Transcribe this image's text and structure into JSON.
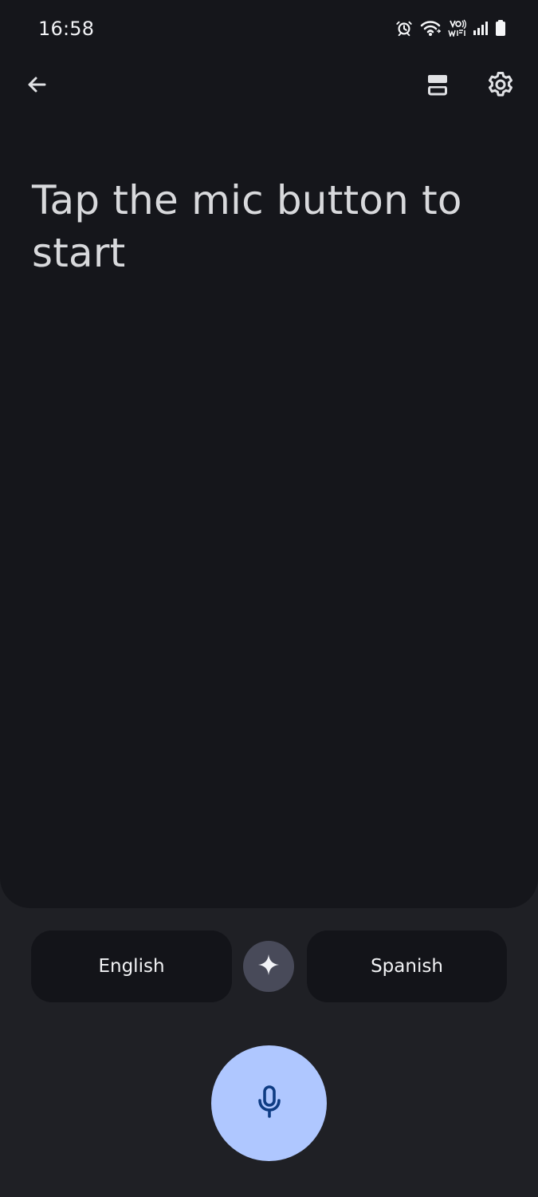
{
  "status_bar": {
    "time": "16:58",
    "icons": [
      "alarm-icon",
      "wifi-icon",
      "vowifi-icon",
      "signal-icon",
      "battery-icon"
    ]
  },
  "toolbar": {
    "back_icon": "back-arrow-icon",
    "layout_icon": "split-layout-icon",
    "settings_icon": "gear-icon"
  },
  "main": {
    "prompt": "Tap the mic button to start"
  },
  "languages": {
    "source": "English",
    "target": "Spanish",
    "swap_icon": "sparkle-icon"
  },
  "mic": {
    "icon": "microphone-icon"
  },
  "colors": {
    "page_background": "#1f2025",
    "panel_background": "#15161b",
    "chip_background": "#131419",
    "swap_background": "#484a59",
    "mic_background": "#afc7ff",
    "mic_icon": "#0e3c83"
  }
}
